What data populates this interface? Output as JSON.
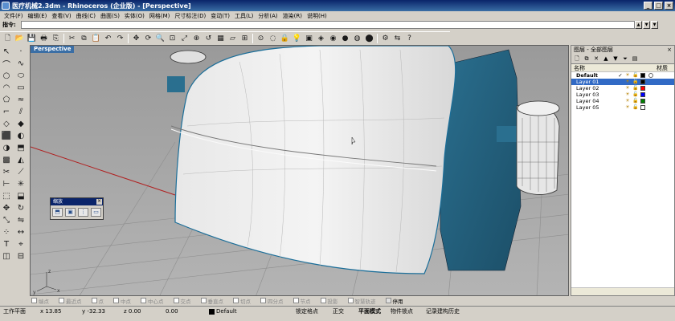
{
  "window": {
    "title": "医疗机械2.3dm - Rhinoceros (企业版) - [Perspective]"
  },
  "menu": [
    "文件(F)",
    "编辑(E)",
    "查看(V)",
    "曲线(C)",
    "曲面(S)",
    "实体(O)",
    "网格(M)",
    "尺寸标注(D)",
    "变动(T)",
    "工具(L)",
    "分析(A)",
    "渲染(R)",
    "说明(H)"
  ],
  "command": {
    "label": "指令:",
    "value": ""
  },
  "viewport": {
    "label": "Perspective"
  },
  "zoom_toolbar": {
    "title": "缩放"
  },
  "layers": {
    "title": "图层 - 全部图层",
    "col_name": "名称",
    "col_material": "材质",
    "rows": [
      {
        "name": "Default",
        "current": "✓",
        "color": "#000000",
        "bold": true,
        "selected": false
      },
      {
        "name": "Layer 01",
        "current": "",
        "color": "#000000",
        "bold": false,
        "selected": true
      },
      {
        "name": "Layer 02",
        "current": "",
        "color": "#ff0000",
        "bold": false,
        "selected": false
      },
      {
        "name": "Layer 03",
        "current": "",
        "color": "#0000ff",
        "bold": false,
        "selected": false
      },
      {
        "name": "Layer 04",
        "current": "",
        "color": "#008000",
        "bold": false,
        "selected": false
      },
      {
        "name": "Layer 05",
        "current": "",
        "color": "#ffffff",
        "bold": false,
        "selected": false
      }
    ]
  },
  "osnaps": [
    {
      "label": "端点",
      "active": false
    },
    {
      "label": "最近点",
      "active": false
    },
    {
      "label": "点",
      "active": false
    },
    {
      "label": "中点",
      "active": false
    },
    {
      "label": "中心点",
      "active": false
    },
    {
      "label": "交点",
      "active": false
    },
    {
      "label": "垂直点",
      "active": false
    },
    {
      "label": "切点",
      "active": false
    },
    {
      "label": "四分点",
      "active": false
    },
    {
      "label": "节点",
      "active": false
    },
    {
      "label": "投影",
      "active": false
    },
    {
      "label": "智慧轨迹",
      "active": false
    },
    {
      "label": "停用",
      "active": true
    }
  ],
  "status": {
    "cplane": "工作平面",
    "x": "x 13.85",
    "y": "y -32.33",
    "z": "z 0.00",
    "extra": "0.00",
    "layer": "Default",
    "snap": "锁定格点",
    "ortho": "正交",
    "planar": "平面模式",
    "osnap": "物件锁点",
    "history": "记录建构历史"
  }
}
